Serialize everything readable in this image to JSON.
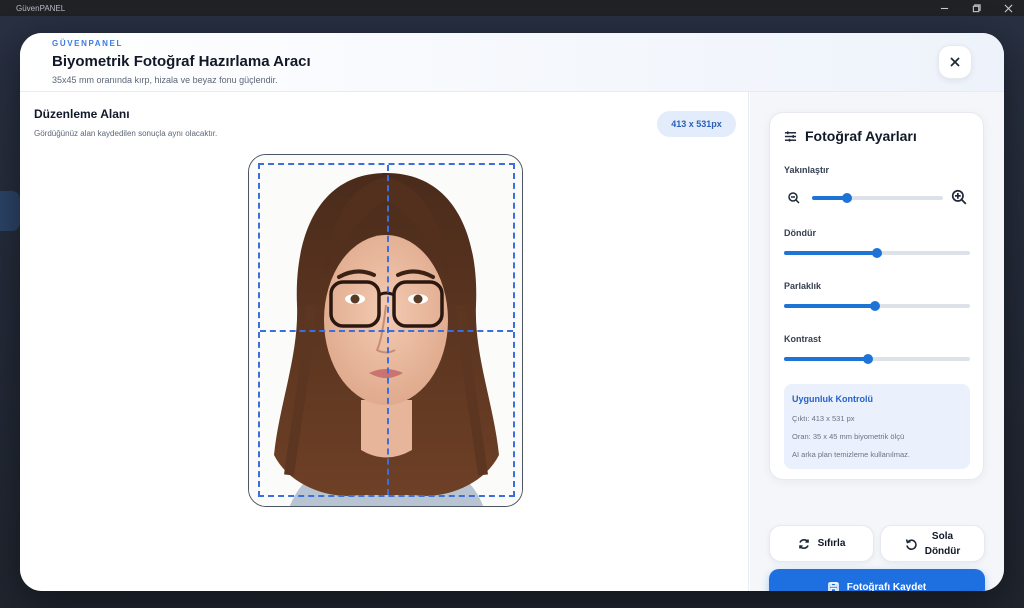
{
  "window": {
    "title": "GüvenPANEL"
  },
  "header": {
    "brand": "GÜVENPANEL",
    "title": "Biyometrik Fotoğraf Hazırlama Aracı",
    "subtitle": "35x45 mm oranında kırp, hizala ve beyaz fonu güçlendir."
  },
  "edit_area": {
    "title": "Düzenleme Alanı",
    "subtitle": "Gördüğünüz alan kaydedilen sonuçla aynı olacaktır.",
    "size_badge": "413 x 531px"
  },
  "settings": {
    "title": "Fotoğraf Ayarları",
    "zoom": {
      "label": "Yakınlaştır",
      "value": 0.27
    },
    "rotate": {
      "label": "Döndür",
      "value": 0.5
    },
    "brightness": {
      "label": "Parlaklık",
      "value": 0.49
    },
    "contrast": {
      "label": "Kontrast",
      "value": 0.45
    },
    "check": {
      "title": "Uygunluk Kontrolü",
      "lines": [
        "Çıktı: 413 x 531 px",
        "Oran: 35 x 45 mm biyometrik ölçü",
        "AI arka plan temizleme kullanılmaz."
      ]
    }
  },
  "buttons": {
    "reset": "Sıfırla",
    "rotate_left_1": "Sola",
    "rotate_left_2": "Döndür",
    "save": "Fotoğrafı Kaydet"
  },
  "colors": {
    "accent": "#1e6fe0",
    "guide": "#3b6fe0",
    "badge_bg": "#e3ecfa"
  }
}
